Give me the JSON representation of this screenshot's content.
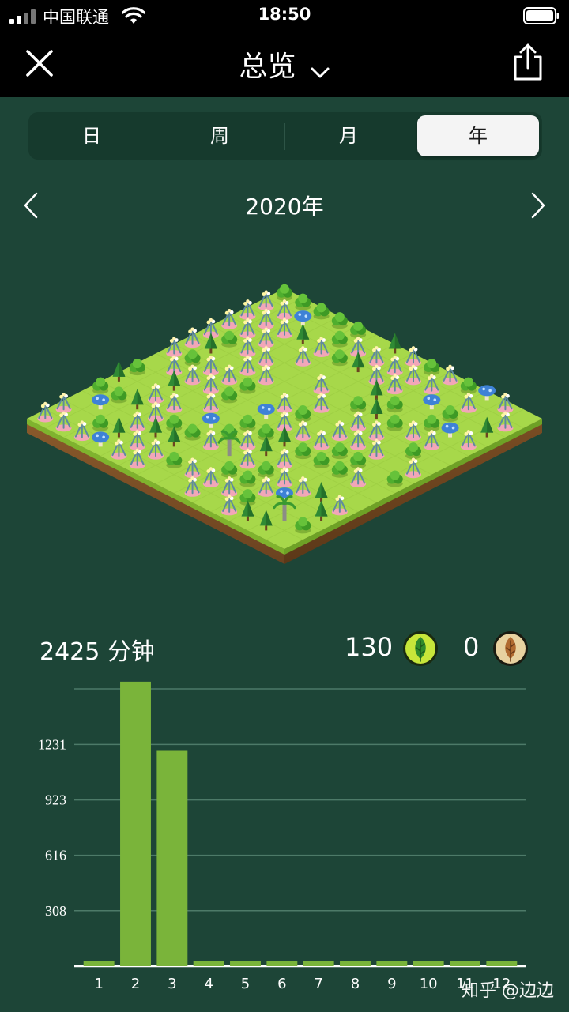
{
  "status_bar": {
    "carrier": "中国联通",
    "time": "18:50",
    "icons": [
      "signal-icon",
      "wifi-icon",
      "battery-icon"
    ]
  },
  "header": {
    "title": "总览",
    "close_icon": "close-icon",
    "dropdown_icon": "chevron-down-icon",
    "share_icon": "share-icon"
  },
  "period_tabs": {
    "items": [
      {
        "label": "日"
      },
      {
        "label": "周"
      },
      {
        "label": "月"
      },
      {
        "label": "年"
      }
    ],
    "selected": "年"
  },
  "year_nav": {
    "label": "2020年",
    "prev_icon": "chevron-left-icon",
    "next_icon": "chevron-right-icon"
  },
  "summary": {
    "minutes": "2425 分钟",
    "alive_trees": "130",
    "dead_trees": "0"
  },
  "colors": {
    "background": "#1d4537",
    "header": "#000000",
    "bar": "#7ab43a",
    "grass": "#a7d84a",
    "alive_icon": "#c7e63a",
    "dead_icon": "#e8d2a0"
  },
  "chart_data": {
    "type": "bar",
    "categories": [
      "1",
      "2",
      "3",
      "4",
      "5",
      "6",
      "7",
      "8",
      "9",
      "10",
      "11",
      "12"
    ],
    "values": [
      30,
      1580,
      1200,
      30,
      30,
      30,
      30,
      30,
      30,
      30,
      30,
      30
    ],
    "yticks": [
      308,
      616,
      923,
      1231
    ],
    "ylim": [
      0,
      1540
    ],
    "grid": true
  },
  "watermark": "知乎 @边边"
}
